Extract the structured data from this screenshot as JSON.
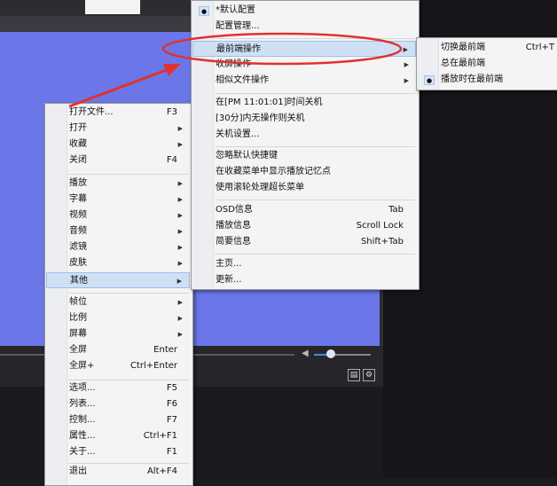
{
  "colors": {
    "video": "#6b77e8",
    "highlight": "#cfe0f5",
    "annotation": "#e0322e",
    "menu_bg": "#f4f4f4"
  },
  "context_menu": {
    "items": [
      {
        "label": "打开文件...",
        "shortcut": "F3"
      },
      {
        "label": "打开",
        "submenu": true
      },
      {
        "label": "收藏",
        "submenu": true
      },
      {
        "label": "关闭",
        "shortcut": "F4"
      },
      {
        "label": "播放",
        "submenu": true
      },
      {
        "label": "字幕",
        "submenu": true
      },
      {
        "label": "视频",
        "submenu": true
      },
      {
        "label": "音频",
        "submenu": true
      },
      {
        "label": "滤镜",
        "submenu": true
      },
      {
        "label": "皮肤",
        "submenu": true
      },
      {
        "label": "其他",
        "submenu": true,
        "highlighted": true
      },
      {
        "label": "帧位",
        "submenu": true
      },
      {
        "label": "比例",
        "submenu": true
      },
      {
        "label": "屏幕",
        "submenu": true
      },
      {
        "label": "全屏",
        "shortcut": "Enter"
      },
      {
        "label": "全屏+",
        "shortcut": "Ctrl+Enter"
      },
      {
        "label": "选项...",
        "shortcut": "F5"
      },
      {
        "label": "列表...",
        "shortcut": "F6"
      },
      {
        "label": "控制...",
        "shortcut": "F7"
      },
      {
        "label": "属性...",
        "shortcut": "Ctrl+F1"
      },
      {
        "label": "关于...",
        "shortcut": "F1"
      },
      {
        "label": "退出",
        "shortcut": "Alt+F4"
      }
    ]
  },
  "other_submenu": {
    "items": [
      {
        "label": "*默认配置",
        "checked": true
      },
      {
        "label": "配置管理..."
      },
      {
        "label": "最前端操作",
        "submenu": true,
        "highlighted": true
      },
      {
        "label": "收屏操作",
        "submenu": true
      },
      {
        "label": "相似文件操作",
        "submenu": true
      },
      {
        "label": "在[PM 11:01:01]时间关机"
      },
      {
        "label": "[30分]内无操作则关机"
      },
      {
        "label": "关机设置..."
      },
      {
        "label": "忽略默认快捷键"
      },
      {
        "label": "在收藏菜单中显示播放记忆点"
      },
      {
        "label": "使用滚轮处理超长菜单"
      },
      {
        "label": "OSD信息",
        "shortcut": "Tab"
      },
      {
        "label": "播放信息",
        "shortcut": "Scroll Lock"
      },
      {
        "label": "简要信息",
        "shortcut": "Shift+Tab"
      },
      {
        "label": "主页..."
      },
      {
        "label": "更新..."
      }
    ]
  },
  "topmost_submenu": {
    "items": [
      {
        "label": "切换最前端",
        "shortcut": "Ctrl+T"
      },
      {
        "label": "总在最前端"
      },
      {
        "label": "播放时在最前端",
        "checked": true
      }
    ]
  },
  "player": {
    "volume": 0.3
  },
  "icons": {
    "check": "bullet-icon",
    "submenu_arrow": "triangle-right-icon",
    "volume": "speaker-icon"
  }
}
